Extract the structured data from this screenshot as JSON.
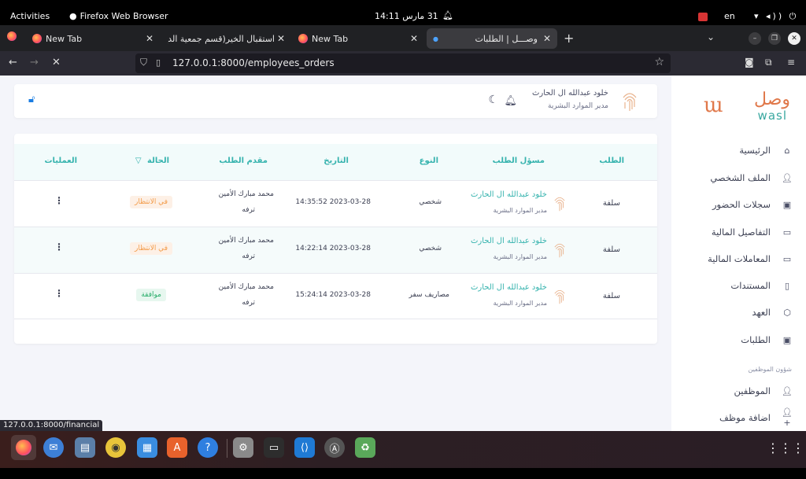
{
  "system_bar": {
    "activities": "Activities",
    "app_name": "Firefox Web Browser",
    "clock": "31 مارس  14:11",
    "language": "en"
  },
  "tabs": [
    {
      "label": "New Tab"
    },
    {
      "label": "استقبال الخير(قسم جمعية الدع"
    },
    {
      "label": "New Tab"
    },
    {
      "label": "وصـــل | الطلبات"
    }
  ],
  "address_bar": {
    "url": "127.0.0.1:8000/employees_orders"
  },
  "status_url": "127.0.0.1:8000/financial",
  "logo": {
    "arabic": "وصل",
    "latin": "wasl"
  },
  "sidebar": {
    "items": [
      {
        "label": "الرئيسية",
        "icon": "home-icon"
      },
      {
        "label": "الملف الشخصي",
        "icon": "user-icon"
      },
      {
        "label": "سجلات الحضور",
        "icon": "calendar-icon"
      },
      {
        "label": "التفاصيل المالية",
        "icon": "card-icon"
      },
      {
        "label": "المعاملات المالية",
        "icon": "card-icon"
      },
      {
        "label": "المستندات",
        "icon": "document-icon"
      },
      {
        "label": "العهد",
        "icon": "box-icon"
      },
      {
        "label": "الطلبات",
        "icon": "calendar-icon"
      }
    ],
    "section_title": "شؤون الموظفين",
    "section_items": [
      {
        "label": "الموظفين",
        "icon": "user-icon"
      },
      {
        "label": "اضافة موظف",
        "icon": "user-plus-icon"
      }
    ]
  },
  "header": {
    "user_name": "خلود عبدالله ال الحارث",
    "user_role": "مدير الموارد البشرية"
  },
  "table": {
    "columns": [
      "الطلب",
      "مسؤل الطلب",
      "النوع",
      "التاريخ",
      "مقدم الطلب",
      "الحالة",
      "العمليات"
    ],
    "rows": [
      {
        "request": "سلفة",
        "owner_name": "خلود عبدالله ال الحارث",
        "owner_role": "مدير الموارد البشرية",
        "type": "شخصي",
        "date": "2023-03-28 14:35:52",
        "applicant_line1": "محمد مبارك الأمين",
        "applicant_line2": "ترفه",
        "status": "في الانتظار",
        "status_kind": "wait"
      },
      {
        "request": "سلفة",
        "owner_name": "خلود عبدالله ال الحارث",
        "owner_role": "مدير الموارد البشرية",
        "type": "شخصي",
        "date": "2023-03-28 14:22:14",
        "applicant_line1": "محمد مبارك الأمين",
        "applicant_line2": "ترفه",
        "status": "في الانتظار",
        "status_kind": "wait"
      },
      {
        "request": "سلفة",
        "owner_name": "خلود عبدالله ال الحارث",
        "owner_role": "مدير الموارد البشرية",
        "type": "مصاريف سفر",
        "date": "2023-03-28 15:24:14",
        "applicant_line1": "محمد مبارك الأمين",
        "applicant_line2": "ترفه",
        "status": "موافقة",
        "status_kind": "ok"
      }
    ]
  },
  "colors": {
    "accent_teal": "#36b3ae",
    "logo_orange": "#e0784a",
    "status_wait": "#f39c4a",
    "status_ok": "#2aae6b",
    "lock_blue": "#1a7de2"
  }
}
